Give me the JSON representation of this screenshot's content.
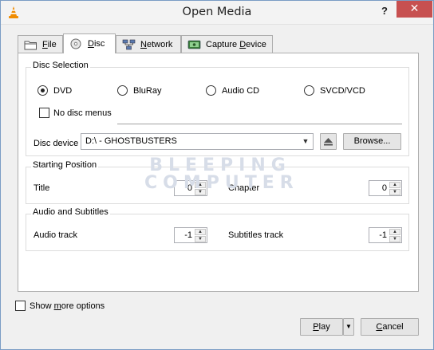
{
  "window": {
    "title": "Open Media",
    "help": "?",
    "close": "✕"
  },
  "tabs": [
    {
      "label": "File",
      "accel_index": 0,
      "icon": "folder-icon"
    },
    {
      "label": "Disc",
      "accel_index": 0,
      "icon": "disc-icon",
      "active": true
    },
    {
      "label": "Network",
      "accel_index": 0,
      "icon": "network-icon"
    },
    {
      "label": "Capture Device",
      "accel_index": 0,
      "icon": "capture-icon"
    }
  ],
  "disc_selection": {
    "title": "Disc Selection",
    "options": [
      {
        "label": "DVD",
        "selected": true
      },
      {
        "label": "BluRay",
        "selected": false
      },
      {
        "label": "Audio CD",
        "selected": false
      },
      {
        "label": "SVCD/VCD",
        "selected": false
      }
    ],
    "no_menus": {
      "label": "No disc menus",
      "checked": false
    },
    "device_label": "Disc device",
    "device_value": "D:\\ - GHOSTBUSTERS",
    "browse_label": "Browse..."
  },
  "starting_position": {
    "title": "Starting Position",
    "title_label": "Title",
    "title_value": "0",
    "chapter_label": "Chapter",
    "chapter_value": "0"
  },
  "audio_subtitles": {
    "title": "Audio and Subtitles",
    "audio_label": "Audio track",
    "audio_value": "-1",
    "subtitles_label": "Subtitles track",
    "subtitles_value": "-1"
  },
  "watermark": {
    "line1": "BLEEPING",
    "line2": "COMPUTER"
  },
  "footer": {
    "show_more": "Show more options",
    "play": "Play",
    "cancel": "Cancel"
  },
  "colors": {
    "close_button": "#c75050",
    "vlc_orange": "#f08c00"
  }
}
